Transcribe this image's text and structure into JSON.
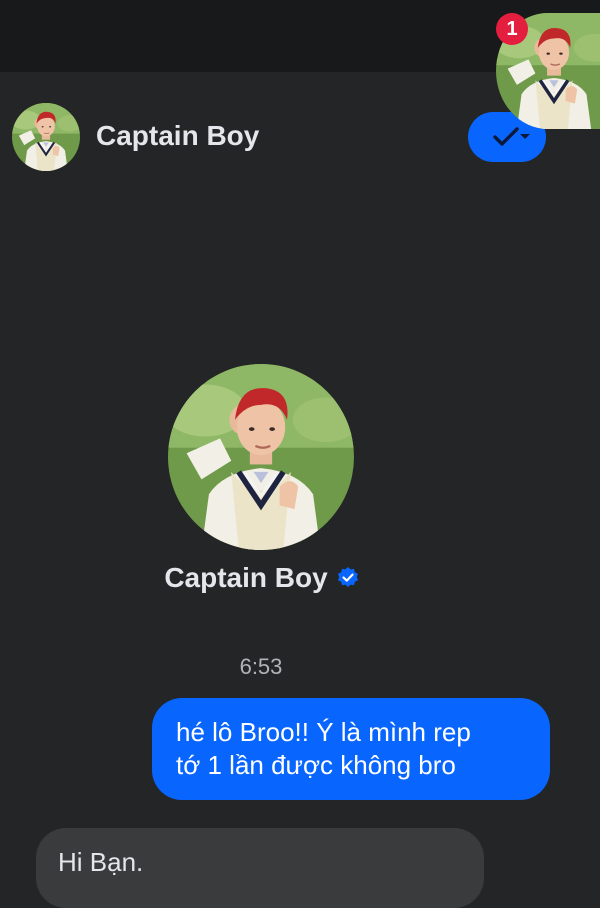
{
  "status_bar": {},
  "chat_head": {
    "badge_count": "1",
    "avatar_icon": "profile-photo"
  },
  "header": {
    "contact_name": "Captain Boy",
    "status_button_icon": "check-chevron-icon",
    "accent_color": "#0866ff"
  },
  "profile": {
    "name": "Captain Boy",
    "verified_icon": "verified-badge-icon",
    "verified_color": "#0866ff"
  },
  "messages": {
    "timestamp": "6:53",
    "items": [
      {
        "direction": "outgoing",
        "text_line1": "hé lô Broo!! Ý là mình rep",
        "text_line2": "tớ 1 lần được không bro"
      },
      {
        "direction": "incoming",
        "text": "Hi Bạn."
      }
    ]
  },
  "colors": {
    "background": "#242526",
    "status_bar": "#18191a",
    "incoming_bubble": "#3a3b3c",
    "badge": "#e41e3f"
  }
}
